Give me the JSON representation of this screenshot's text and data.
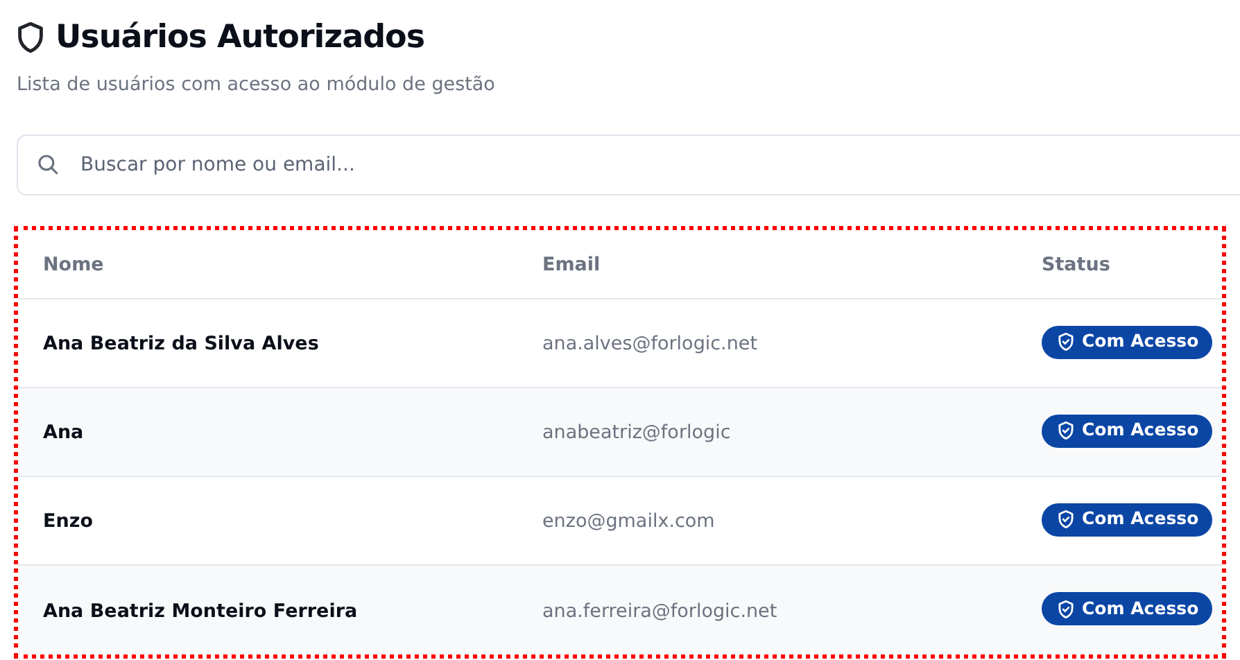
{
  "header": {
    "title": "Usuários Autorizados",
    "subtitle": "Lista de usuários com acesso ao módulo de gestão"
  },
  "search": {
    "placeholder": "Buscar por nome ou email..."
  },
  "table": {
    "columns": [
      "Nome",
      "Email",
      "Status"
    ],
    "rows": [
      {
        "name": "Ana Beatriz da Silva Alves",
        "email": "ana.alves@forlogic.net",
        "status": "Com Acesso"
      },
      {
        "name": "Ana",
        "email": "anabeatriz@forlogic",
        "status": "Com Acesso"
      },
      {
        "name": "Enzo",
        "email": "enzo@gmailx.com",
        "status": "Com Acesso"
      },
      {
        "name": "Ana Beatriz Monteiro Ferreira",
        "email": "ana.ferreira@forlogic.net",
        "status": "Com Acesso"
      }
    ]
  }
}
